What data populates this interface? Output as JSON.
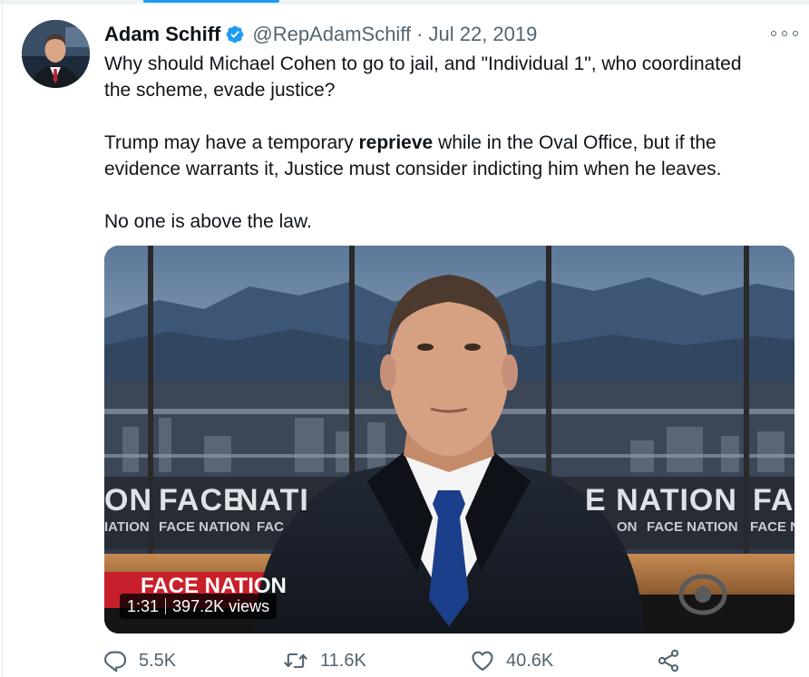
{
  "author": {
    "name": "Adam Schiff",
    "handle": "@RepAdamSchiff",
    "separator": "·",
    "date": "Jul 22, 2019"
  },
  "tweet": {
    "line1_a": "Why should Michael Cohen to go to jail, and \"Individual 1\", who coordinated",
    "line1_b": "the scheme, evade justice?",
    "line2_pre": "Trump may have a temporary ",
    "line2_bold": "reprieve",
    "line2_post": " while in the Oval Office, but if the",
    "line2_b": "evidence warrants it, Justice must consider indicting him when he leaves.",
    "line3": "No one is above the law."
  },
  "media": {
    "duration": "1:31",
    "views": "397.2K views",
    "banner_main_left": "ON",
    "banner_main_mid": "FACE",
    "banner_main_mid2": "NATI",
    "banner_main_right": "E NATION",
    "banner_main_far": "FAC",
    "banner_sub_left": "IATION",
    "banner_sub_mid": "FACE NATION",
    "banner_sub_mid2": "FAC",
    "banner_sub_right": "ON",
    "banner_sub_right2": "FACE NATION",
    "banner_sub_far": "FACE N",
    "lower_logo": "FACE NATION"
  },
  "actions": {
    "replies": "5.5K",
    "retweets": "11.6K",
    "likes": "40.6K"
  },
  "colors": {
    "accent": "#1d9bf0",
    "secondary_text": "#536471"
  },
  "icons": [
    "verified-badge-icon",
    "more-options-icon",
    "reply-icon",
    "retweet-icon",
    "like-icon",
    "share-icon"
  ]
}
